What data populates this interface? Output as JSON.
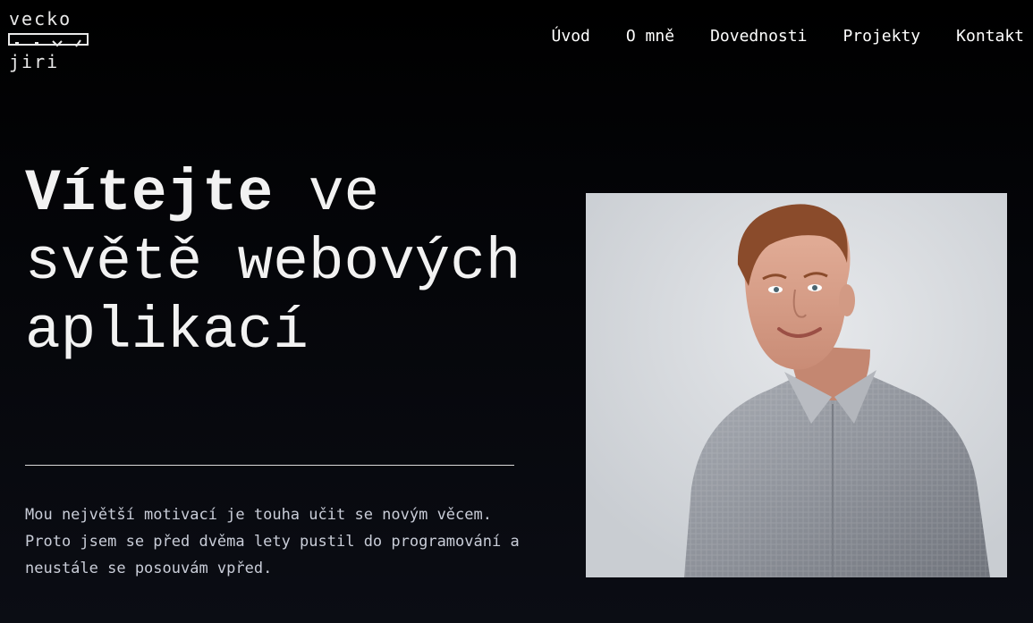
{
  "logo": {
    "top_word": "vecko",
    "bottom_word": "jiri"
  },
  "nav": {
    "items": [
      {
        "label": "Úvod"
      },
      {
        "label": "O mně"
      },
      {
        "label": "Dovednosti"
      },
      {
        "label": "Projekty"
      },
      {
        "label": "Kontakt"
      }
    ]
  },
  "hero": {
    "title_strong": "Vítejte",
    "title_rest": " ve světě webových aplikací",
    "description": "Mou největší motivací je touha učit se novým věcem. Proto jsem se před dvěma lety pustil do programování a neustále se posouvám vpřed."
  },
  "colors": {
    "background": "#000000",
    "text": "#ffffff",
    "muted_text": "#c9cdd8",
    "divider": "#d9d9d9"
  }
}
